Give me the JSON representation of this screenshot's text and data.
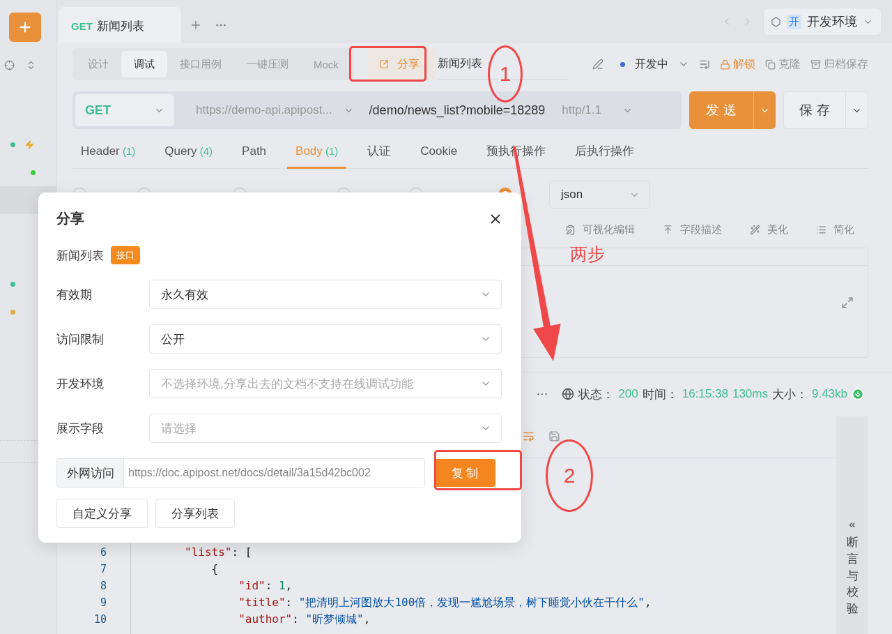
{
  "sidebar": {
    "rows": [
      {
        "kind": "dot-bolt",
        "color": "#3dbf8f",
        "selected": false
      },
      {
        "kind": "dot-inner",
        "color": "#3ad13a",
        "selected": false
      },
      {
        "kind": "blank",
        "selected": true
      },
      {
        "kind": "dot",
        "color": "#3dbf8f",
        "selected": false
      },
      {
        "kind": "dot",
        "color": "#e6a93a",
        "selected": false
      }
    ]
  },
  "tabs": [
    {
      "method": "GET",
      "title": "新闻列表",
      "selected": true
    }
  ],
  "env": {
    "badge": "开",
    "name": "开发环境"
  },
  "mode_tabs": [
    {
      "label": "设计",
      "selected": false
    },
    {
      "label": "调试",
      "selected": true
    },
    {
      "label": "接口用例",
      "selected": false
    },
    {
      "label": "一键压测",
      "selected": false
    },
    {
      "label": "Mock",
      "selected": false
    }
  ],
  "share_button": "分享",
  "api_name": "新闻列表",
  "status": "开发中",
  "actions": [
    {
      "kind": "unlock",
      "label": "解锁"
    },
    {
      "kind": "clone",
      "label": "克隆"
    },
    {
      "kind": "archive",
      "label": "归档保存"
    }
  ],
  "request": {
    "method": "GET",
    "base_url": "https://demo-api.apipost...",
    "path": "/demo/news_list?mobile=18289",
    "protocol": "http/1.1"
  },
  "send_button": "发 送",
  "save_button": "保 存",
  "param_tabs": [
    {
      "label": "Header",
      "count": "(1)",
      "selected": false
    },
    {
      "label": "Query",
      "count": "(4)",
      "selected": false
    },
    {
      "label": "Path",
      "selected": false
    },
    {
      "label": "Body",
      "count": "(1)",
      "selected": true
    },
    {
      "label": "认证",
      "selected": false
    },
    {
      "label": "Cookie",
      "selected": false
    },
    {
      "label": "预执行操作",
      "selected": false
    },
    {
      "label": "后执行操作",
      "selected": false
    }
  ],
  "body_types": [
    {
      "selected": false
    },
    {
      "selected": false
    },
    {
      "selected": false
    },
    {
      "selected": false
    },
    {
      "selected": false
    },
    {
      "selected": true
    }
  ],
  "format": "json",
  "editor_tools": [
    {
      "kind": "visual",
      "label": "可视化编辑"
    },
    {
      "kind": "describe",
      "label": "字段描述"
    },
    {
      "kind": "beautify",
      "label": "美化"
    },
    {
      "kind": "simplify",
      "label": "简化"
    }
  ],
  "response": {
    "more": "···",
    "status_label": "状态：",
    "status": "200",
    "time_label": "时间：",
    "time": "16:15:38",
    "duration": "130ms",
    "size_label": "大小：",
    "size": "9.43kb"
  },
  "code_lines": [
    {
      "number": "6",
      "tokens": [
        {
          "kind": "key",
          "text": "        \"lists\""
        },
        {
          "kind": "punct",
          "text": ": ["
        }
      ]
    },
    {
      "number": "7",
      "tokens": [
        {
          "kind": "punct",
          "text": "            {"
        }
      ]
    },
    {
      "number": "8",
      "tokens": [
        {
          "kind": "key",
          "text": "                \"id\""
        },
        {
          "kind": "punct",
          "text": ": "
        },
        {
          "kind": "number",
          "text": "1"
        },
        {
          "kind": "punct",
          "text": ","
        }
      ]
    },
    {
      "number": "9",
      "tokens": [
        {
          "kind": "key",
          "text": "                \"title\""
        },
        {
          "kind": "punct",
          "text": ": "
        },
        {
          "kind": "string",
          "text": "\"把清明上河图放大100倍，发现一尴尬场景，树下睡觉小伙在干什么\""
        },
        {
          "kind": "punct",
          "text": ","
        }
      ]
    },
    {
      "number": "10",
      "tokens": [
        {
          "kind": "key",
          "text": "                \"author\""
        },
        {
          "kind": "punct",
          "text": ": "
        },
        {
          "kind": "string",
          "text": "\"昕梦倾城\""
        },
        {
          "kind": "punct",
          "text": ","
        }
      ]
    }
  ],
  "side_panel": {
    "arrow": "«",
    "label": "断言与校验"
  },
  "modal": {
    "title": "分享",
    "name": "新闻列表",
    "tag": "接口",
    "fields": [
      {
        "label": "有效期",
        "value": "永久有效"
      },
      {
        "label": "访问限制",
        "value": "公开"
      },
      {
        "label": "开发环境",
        "placeholder": "不选择环境,分享出去的文档不支持在线调试功能"
      },
      {
        "label": "展示字段",
        "placeholder": "请选择"
      }
    ],
    "link": {
      "label": "外网访问",
      "value": "https://doc.apipost.net/docs/detail/3a15d42bc002"
    },
    "copy_button": "复 制",
    "buttons": [
      "自定义分享",
      "分享列表"
    ]
  },
  "annotations": [
    {
      "kind": "rect"
    },
    {
      "kind": "ellipse",
      "text": "1"
    },
    {
      "kind": "arrow"
    },
    {
      "kind": "note",
      "text": "两步"
    },
    {
      "kind": "rect"
    },
    {
      "kind": "ellipse",
      "text": "2"
    }
  ]
}
